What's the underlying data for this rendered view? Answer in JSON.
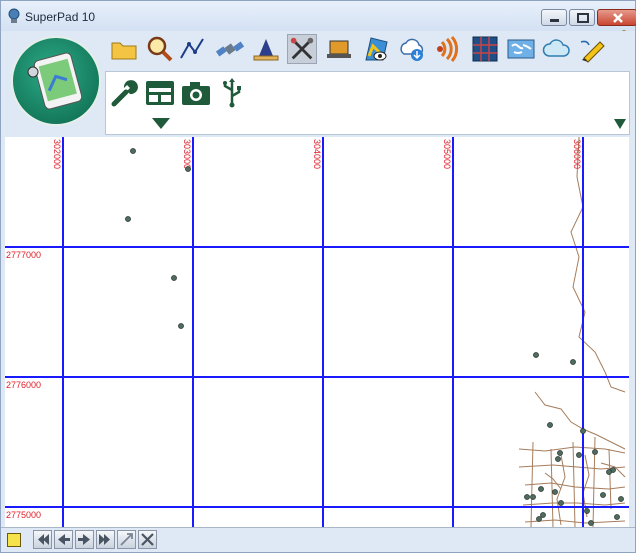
{
  "window": {
    "title": "SuperPad 10"
  },
  "toolbar": {
    "icons": [
      "folder-icon",
      "search-icon",
      "pen-line-icon",
      "satellite-icon",
      "measure-icon",
      "tools-icon",
      "laptop-icon",
      "map-view-icon",
      "cloud-download-icon",
      "signal-icon",
      "grid-icon",
      "world-map-icon",
      "cloud-icon",
      "edit-pencil-icon"
    ],
    "active_icon": "tools-icon"
  },
  "panel": {
    "icons": [
      "wrench-icon",
      "layout-icon",
      "camera-icon",
      "usb-icon"
    ]
  },
  "map": {
    "x_labels": [
      "302000",
      "303000",
      "304000",
      "305000",
      "306000"
    ],
    "y_labels": [
      "2777000",
      "2776000",
      "2775000"
    ],
    "grid_color": "#1a1aff",
    "label_color": "#e0202a",
    "road_color": "#a67d5c",
    "point_color": "#4f6b5e"
  },
  "statusbar": {
    "buttons": [
      "first-icon",
      "prev-icon",
      "next-icon",
      "last-icon",
      "zoom-extent-icon",
      "close-x-icon"
    ]
  }
}
